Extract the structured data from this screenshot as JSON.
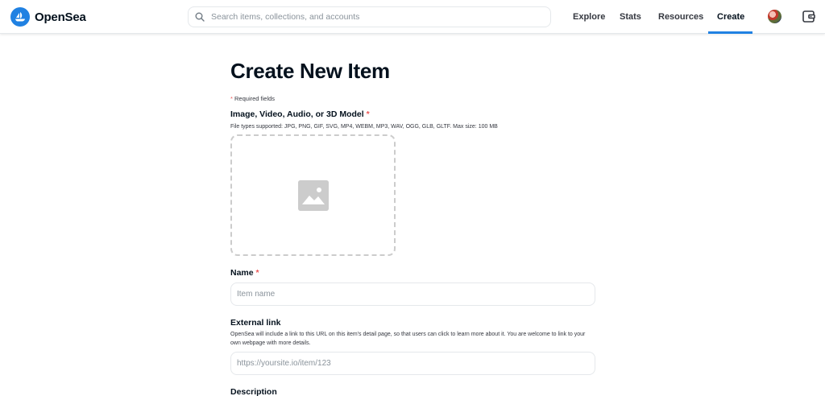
{
  "brand": {
    "name": "OpenSea",
    "accent": "#2081e2"
  },
  "search": {
    "placeholder": "Search items, collections, and accounts"
  },
  "nav": {
    "items": [
      "Explore",
      "Stats",
      "Resources",
      "Create"
    ],
    "active": "Create"
  },
  "icons": {
    "logo": "opensea-sailboat-icon",
    "search": "search-icon",
    "avatar": "user-avatar",
    "wallet": "wallet-icon",
    "upload_placeholder": "image-icon"
  },
  "form": {
    "title": "Create New Item",
    "required_note": "Required fields",
    "required_mark": "*",
    "media": {
      "label": "Image, Video, Audio, or 3D Model",
      "help": "File types supported: JPG, PNG, GIF, SVG, MP4, WEBM, MP3, WAV, OGG, GLB, GLTF. Max size: 100 MB"
    },
    "name": {
      "label": "Name",
      "placeholder": "Item name",
      "value": ""
    },
    "external_link": {
      "label": "External link",
      "help": "OpenSea will include a link to this URL on this item's detail page, so that users can click to learn more about it. You are welcome to link to your own webpage with more details.",
      "placeholder": "https://yoursite.io/item/123",
      "value": ""
    },
    "description": {
      "label": "Description"
    }
  }
}
